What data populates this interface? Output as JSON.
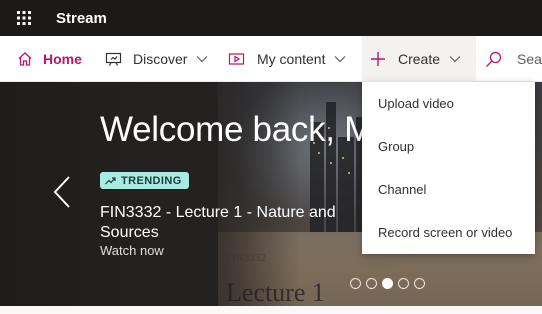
{
  "app": {
    "title": "Stream",
    "waffle_icon": "waffle-icon"
  },
  "nav": {
    "home_label": "Home",
    "discover_label": "Discover",
    "mycontent_label": "My content",
    "create_label": "Create",
    "search_placeholder": "Sear"
  },
  "hero": {
    "welcome": "Welcome back, M",
    "trending_badge": "TRENDING",
    "video_title": "FIN3332 - Lecture 1 - Nature and Sources",
    "watch_now": "Watch now",
    "slide_course": "FIN3332",
    "slide_heading": "Lecture 1",
    "carousel_total": 5,
    "carousel_active_index": 2
  },
  "create_menu": {
    "items": [
      {
        "label": "Upload video"
      },
      {
        "label": "Group"
      },
      {
        "label": "Channel"
      },
      {
        "label": "Record screen or video"
      }
    ]
  },
  "colors": {
    "accent": "#b4166a",
    "appbar": "#1b1a19",
    "trending_bg": "#a6ece0"
  }
}
